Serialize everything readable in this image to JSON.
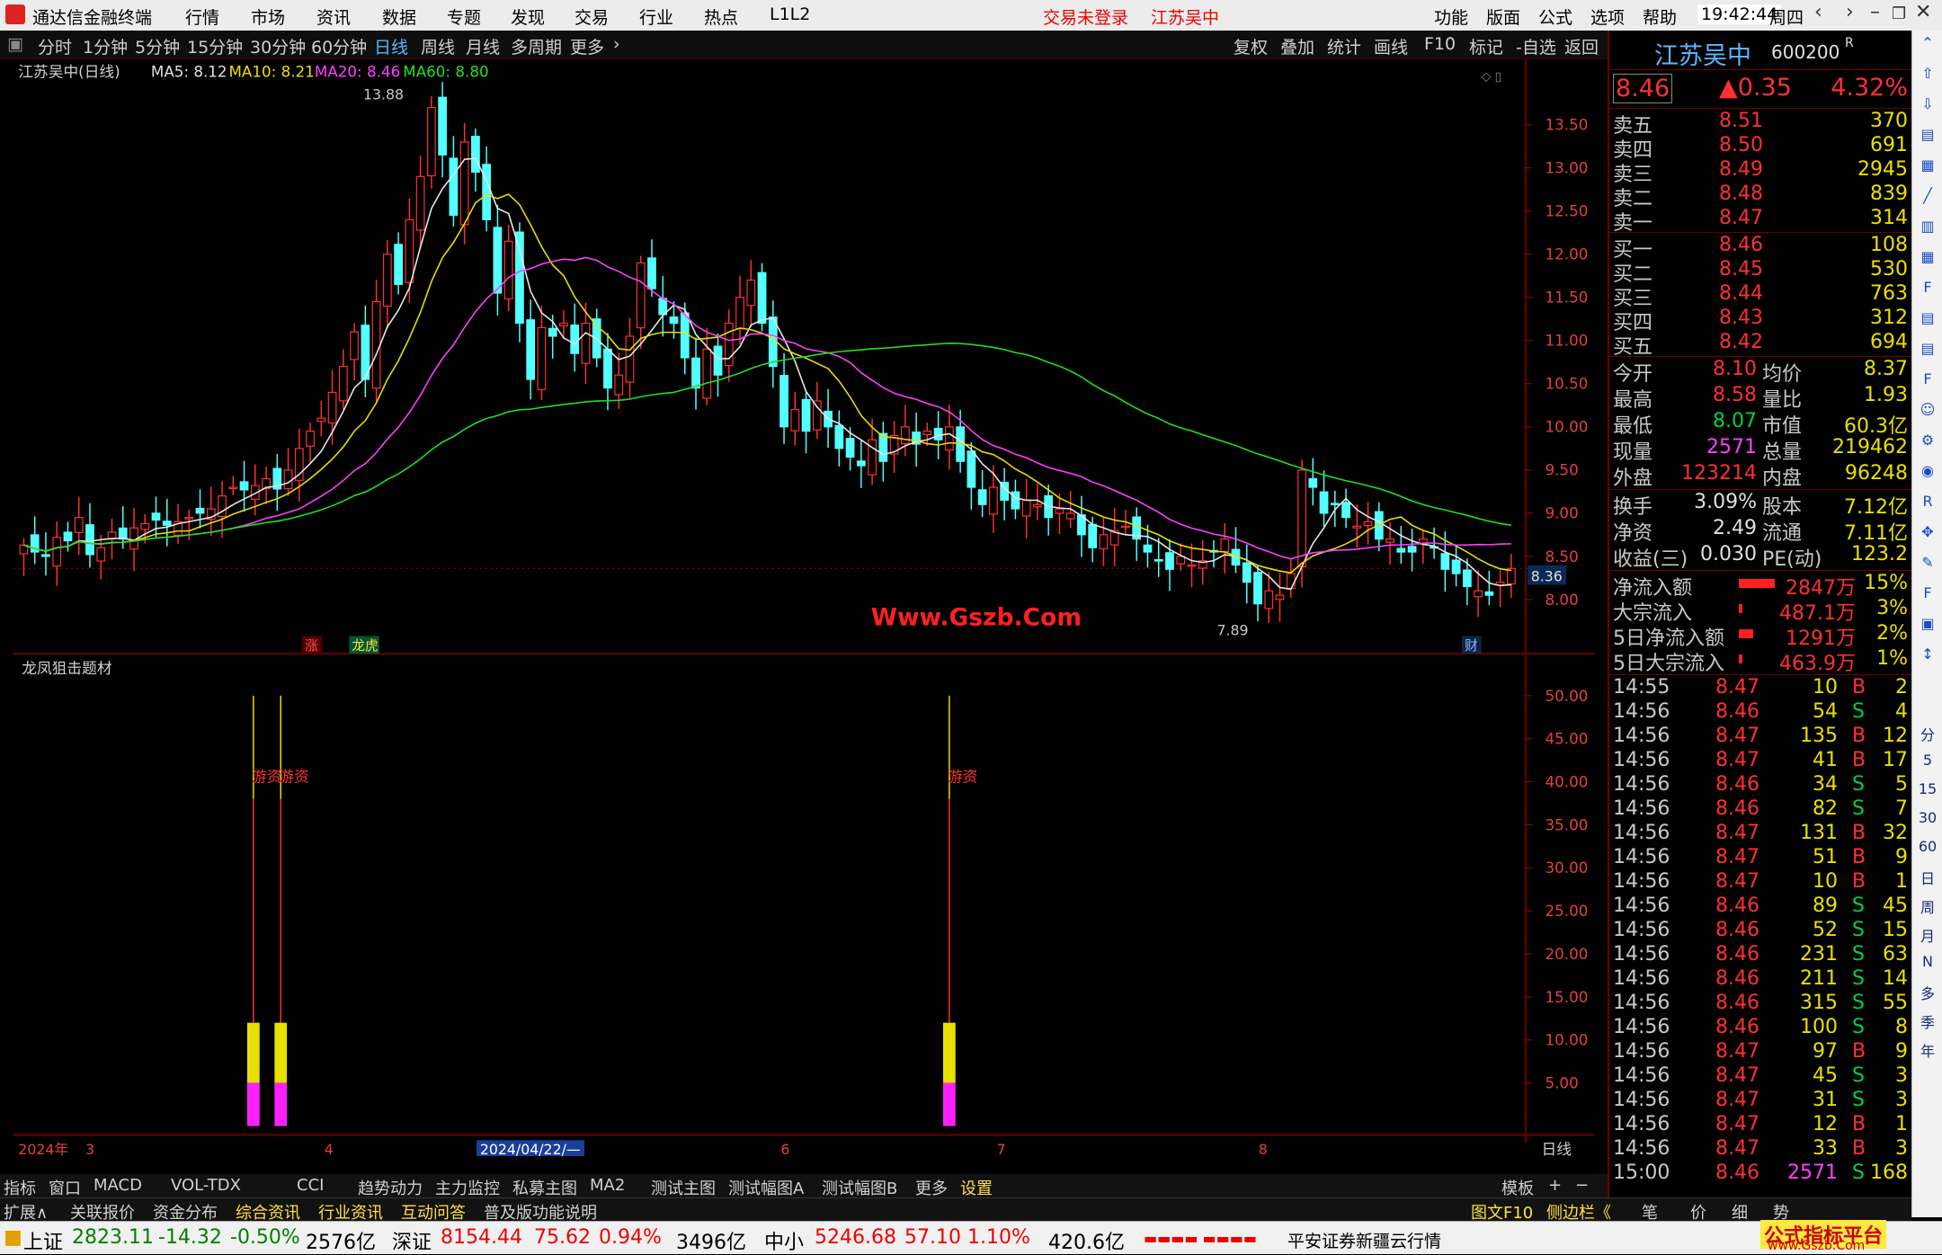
{
  "menubar": {
    "app_title": "通达信金融终端",
    "items": [
      "行情",
      "市场",
      "资讯",
      "数据",
      "专题",
      "发现",
      "交易",
      "行业",
      "热点",
      "L1L2"
    ],
    "login_status": "交易未登录",
    "stock_name_red": "江苏吴中",
    "right_items": [
      "功能",
      "版面",
      "公式",
      "选项",
      "帮助"
    ],
    "time": "19:42:44",
    "weekday": "周四"
  },
  "periodbar": {
    "items": [
      "分时",
      "1分钟",
      "5分钟",
      "15分钟",
      "30分钟",
      "60分钟",
      "日线",
      "周线",
      "月线",
      "多周期",
      "更多"
    ],
    "selected": "日线",
    "right_items": [
      "复权",
      "叠加",
      "统计",
      "画线",
      "F10",
      "标记",
      "-自选",
      "返回"
    ]
  },
  "chart_header": {
    "name": "江苏吴中(日线)",
    "ma5": "MA5: 8.12",
    "ma10": "MA10: 8.21",
    "ma20": "MA20: 8.46",
    "ma60": "MA60: 8.80",
    "high_label": "13.88",
    "low_label": "7.89",
    "current": "8.36",
    "tag_zhang": "涨",
    "tag_rank": "龙虎",
    "tag_cai": "财",
    "watermark": "Www.Gszb.Com"
  },
  "indicator": {
    "name": "龙凤狙击题材",
    "signal_label": "游资"
  },
  "chart_data": [
    {
      "type": "candlestick",
      "title": "江苏吴中(日线)",
      "y_ticks": [
        "13.50",
        "13.00",
        "12.50",
        "12.00",
        "11.50",
        "11.00",
        "10.50",
        "10.00",
        "9.50",
        "9.00",
        "8.50",
        "8.00"
      ],
      "ylim": [
        7.7,
        13.95
      ],
      "x_labels": [
        "2024年",
        "3",
        "4",
        "2024/04/22/—",
        "6",
        "7",
        "8"
      ],
      "close": [
        8.63,
        8.55,
        8.5,
        8.72,
        8.68,
        8.95,
        8.52,
        8.6,
        8.78,
        8.7,
        8.83,
        8.88,
        8.92,
        8.86,
        8.9,
        8.95,
        9.0,
        9.05,
        9.2,
        9.3,
        9.27,
        9.32,
        9.4,
        9.28,
        9.5,
        9.75,
        9.95,
        10.1,
        10.4,
        10.7,
        11.1,
        10.55,
        11.45,
        12.0,
        11.65,
        12.4,
        12.9,
        13.7,
        13.15,
        12.45,
        13.3,
        12.95,
        12.4,
        11.55,
        12.15,
        11.2,
        10.55,
        11.15,
        11.05,
        11.2,
        10.85,
        11.2,
        10.8,
        10.45,
        10.6,
        11.05,
        11.9,
        11.6,
        11.3,
        11.2,
        10.8,
        10.45,
        10.9,
        10.6,
        11.2,
        11.5,
        11.7,
        11.2,
        10.7,
        10.0,
        10.2,
        9.95,
        10.3,
        10.0,
        9.75,
        9.65,
        9.55,
        9.85,
        9.6,
        9.9,
        10.0,
        9.8,
        9.95,
        9.85,
        10.0,
        9.6,
        9.3,
        9.1,
        9.3,
        9.15,
        9.05,
        9.15,
        9.1,
        8.95,
        9.05,
        9.0,
        8.75,
        8.6,
        8.75,
        8.8,
        8.85,
        8.7,
        8.55,
        8.45,
        8.35,
        8.5,
        8.4,
        8.45,
        8.55,
        8.7,
        8.4,
        8.2,
        7.95,
        8.1,
        8.05,
        8.3,
        9.5,
        9.3,
        9.0,
        9.1,
        8.95,
        8.85,
        8.9,
        8.7,
        8.7,
        8.55,
        8.55,
        8.7,
        8.6,
        8.35,
        8.3,
        8.15,
        8.1,
        8.05,
        8.2,
        8.36
      ],
      "ma5": "short",
      "ma10": "mid",
      "ma20": "long",
      "ma60": "longest"
    },
    {
      "type": "bar",
      "title": "龙凤狙击题材",
      "y_ticks": [
        "50.00",
        "45.00",
        "40.00",
        "35.00",
        "30.00",
        "25.00",
        "20.00",
        "15.00",
        "10.00",
        "5.00"
      ],
      "ylim": [
        0,
        52
      ],
      "signals": [
        {
          "index": 21,
          "value": 50
        },
        {
          "index": 23,
          "value": 50
        },
        {
          "index": 84,
          "value": 50
        }
      ],
      "yellow_value": 12,
      "magenta_value": 5
    }
  ],
  "quote": {
    "name": "江苏吴中",
    "code": "600200",
    "price": "8.46",
    "change": "▲0.35",
    "pct": "4.32%",
    "asks": [
      {
        "k": "卖五",
        "p": "8.51",
        "v": "370"
      },
      {
        "k": "卖四",
        "p": "8.50",
        "v": "691"
      },
      {
        "k": "卖三",
        "p": "8.49",
        "v": "2945"
      },
      {
        "k": "卖二",
        "p": "8.48",
        "v": "839"
      },
      {
        "k": "卖一",
        "p": "8.47",
        "v": "314"
      }
    ],
    "bids": [
      {
        "k": "买一",
        "p": "8.46",
        "v": "108"
      },
      {
        "k": "买二",
        "p": "8.45",
        "v": "530"
      },
      {
        "k": "买三",
        "p": "8.44",
        "v": "763"
      },
      {
        "k": "买四",
        "p": "8.43",
        "v": "312"
      },
      {
        "k": "买五",
        "p": "8.42",
        "v": "694"
      }
    ],
    "stats": [
      [
        "今开",
        "8.10",
        "均价",
        "8.37"
      ],
      [
        "最高",
        "8.58",
        "量比",
        "1.93"
      ],
      [
        "最低",
        "8.07",
        "市值",
        "60.3亿"
      ],
      [
        "现量",
        "2571",
        "总量",
        "219462"
      ],
      [
        "外盘",
        "123214",
        "内盘",
        "96248"
      ]
    ],
    "stats2": [
      [
        "换手",
        "3.09%",
        "股本",
        "7.12亿"
      ],
      [
        "净资",
        "2.49",
        "流通",
        "7.11亿"
      ],
      [
        "收益(三)",
        "0.030",
        "PE(动)",
        "123.2"
      ]
    ],
    "flows": [
      [
        "净流入额",
        "2847万",
        "15%"
      ],
      [
        "大宗流入",
        "487.1万",
        "3%"
      ],
      [
        "5日净流入额",
        "1291万",
        "2%"
      ],
      [
        "5日大宗流入",
        "463.9万",
        "1%"
      ]
    ],
    "ticks": [
      [
        "14:55",
        "8.47",
        "10",
        "B",
        "2"
      ],
      [
        "14:56",
        "8.46",
        "54",
        "S",
        "4"
      ],
      [
        "14:56",
        "8.47",
        "135",
        "B",
        "12"
      ],
      [
        "14:56",
        "8.47",
        "41",
        "B",
        "17"
      ],
      [
        "14:56",
        "8.46",
        "34",
        "S",
        "5"
      ],
      [
        "14:56",
        "8.46",
        "82",
        "S",
        "7"
      ],
      [
        "14:56",
        "8.47",
        "131",
        "B",
        "32"
      ],
      [
        "14:56",
        "8.47",
        "51",
        "B",
        "9"
      ],
      [
        "14:56",
        "8.47",
        "10",
        "B",
        "1"
      ],
      [
        "14:56",
        "8.46",
        "89",
        "S",
        "45"
      ],
      [
        "14:56",
        "8.46",
        "52",
        "S",
        "15"
      ],
      [
        "14:56",
        "8.46",
        "231",
        "S",
        "63"
      ],
      [
        "14:56",
        "8.46",
        "211",
        "S",
        "14"
      ],
      [
        "14:56",
        "8.46",
        "315",
        "S",
        "55"
      ],
      [
        "14:56",
        "8.46",
        "100",
        "S",
        "8"
      ],
      [
        "14:56",
        "8.47",
        "97",
        "B",
        "9"
      ],
      [
        "14:56",
        "8.47",
        "45",
        "S",
        "3"
      ],
      [
        "14:56",
        "8.47",
        "31",
        "S",
        "3"
      ],
      [
        "14:56",
        "8.47",
        "12",
        "B",
        "1"
      ],
      [
        "14:56",
        "8.47",
        "33",
        "B",
        "3"
      ],
      [
        "15:00",
        "8.46",
        "2571",
        "S",
        "168"
      ]
    ]
  },
  "indicator_tabs": [
    "指标",
    "窗口",
    "MACD",
    "VOL-TDX",
    "CCI",
    "趋势动力",
    "主力监控",
    "私募主图",
    "MA2",
    "测试主图",
    "测试幅图A",
    "测试幅图B",
    "更多",
    "设置"
  ],
  "tabs_right": {
    "template": "模板",
    "plus": "+",
    "minus": "−",
    "period": "日线"
  },
  "tabs2": [
    "扩展∧",
    "关联报价",
    "资金分布",
    "综合资讯",
    "行业资讯",
    "互动问答",
    "普及版功能说明"
  ],
  "tabs2_right": [
    "图文F10",
    "侧边栏《",
    "笔",
    "价",
    "细",
    "势"
  ],
  "sidebar_labels": [
    "分",
    "5",
    "15",
    "30",
    "60",
    "日",
    "周",
    "月",
    "N",
    "多",
    "季",
    "年"
  ],
  "bottom": {
    "sh_name": "上证",
    "sh_val": "2823.11",
    "sh_chg": "-14.32",
    "sh_pct": "-0.50%",
    "sh_amt": "2576亿",
    "sz_name": "深证",
    "sz_val": "8154.44",
    "sz_chg": "75.62",
    "sz_pct": "0.94%",
    "sz_amt": "3496亿",
    "zx_name": "中小",
    "zx_val": "5246.68",
    "zx_chg": "57.10",
    "zx_pct": "1.10%",
    "zx_amt": "420.6亿",
    "broker": "平安证券新疆云行情",
    "brand": "公式指标平台",
    "brand_url": "www.Gszb.Com"
  }
}
